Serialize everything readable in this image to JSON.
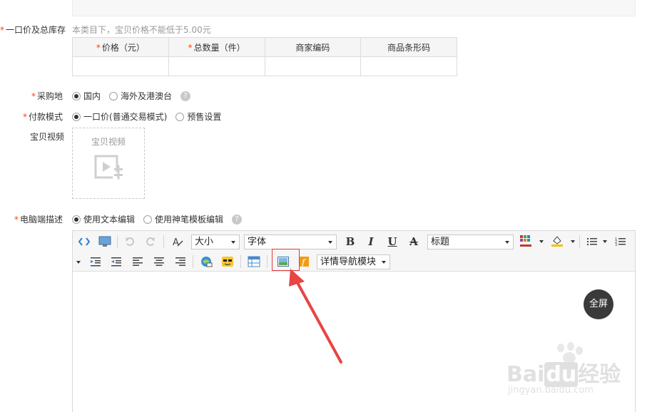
{
  "price_section": {
    "label": "一口价及总库存",
    "hint": "本类目下，宝贝价格不能低于5.00元",
    "columns": [
      {
        "required": true,
        "label": "价格（元）"
      },
      {
        "required": true,
        "label": "总数量（件）"
      },
      {
        "required": false,
        "label": "商家编码"
      },
      {
        "required": false,
        "label": "商品条形码"
      }
    ]
  },
  "origin": {
    "label": "采购地",
    "options": [
      {
        "label": "国内",
        "checked": true
      },
      {
        "label": "海外及港澳台",
        "checked": false
      }
    ]
  },
  "payment": {
    "label": "付款模式",
    "options": [
      {
        "label": "一口价(普通交易模式)",
        "checked": true
      },
      {
        "label": "预售设置",
        "checked": false
      }
    ]
  },
  "video": {
    "label": "宝贝视频",
    "box_label": "宝贝视频",
    "icon": "video-add-icon"
  },
  "description": {
    "label": "电脑端描述",
    "options": [
      {
        "label": "使用文本编辑",
        "checked": true
      },
      {
        "label": "使用神笔模板编辑",
        "checked": false
      }
    ]
  },
  "editor": {
    "toolbar_row1": {
      "icons": [
        "source-code-icon",
        "preview-icon",
        "undo-icon",
        "redo-icon",
        "format-clear-icon"
      ],
      "size_select": "大小",
      "font_select": "字体",
      "format_buttons": [
        "B",
        "I",
        "U",
        "A"
      ],
      "heading_select": "标题",
      "color_icons": [
        "font-color-icon",
        "background-color-icon"
      ],
      "list_icons": [
        "bullet-list-icon",
        "numbered-list-icon"
      ]
    },
    "toolbar_row2": {
      "icons": [
        "indent-icon",
        "outdent-icon",
        "align-left-icon",
        "align-center-icon",
        "align-right-icon",
        "link-icon",
        "emoticon-icon",
        "table-icon",
        "image-icon",
        "flash-icon"
      ],
      "nav_module_select": "详情导航模块"
    },
    "fullscreen_label": "全屏"
  },
  "watermark": {
    "line1": "Bai",
    "line1b": "du",
    "line1c": "经验",
    "line2": "jingyan.baidu.com"
  },
  "colors": {
    "required_star": "#ff4400",
    "annotation_red": "#e03a3a",
    "hint_gray": "#999999"
  }
}
